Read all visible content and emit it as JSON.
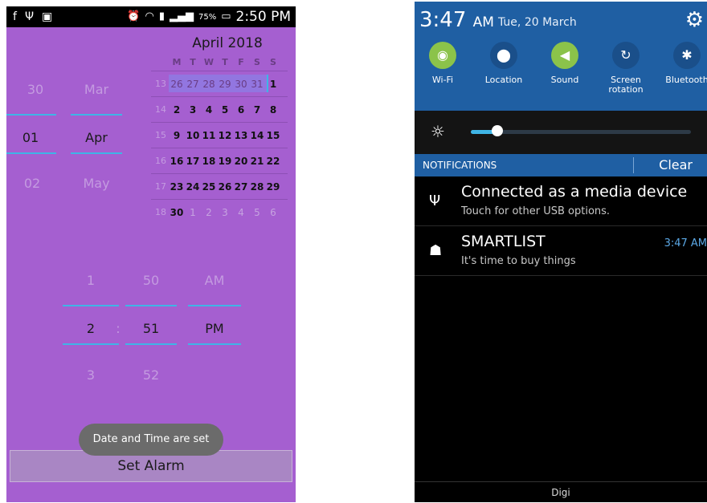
{
  "left_phone": {
    "status_bar": {
      "left_icons": [
        "facebook-icon",
        "usb-icon",
        "image-icon"
      ],
      "battery_percent": "75%",
      "time": "2:50 PM"
    },
    "date_picker": {
      "day": {
        "prev": "30",
        "selected": "01",
        "next": "02"
      },
      "month": {
        "prev": "Mar",
        "selected": "Apr",
        "next": "May"
      }
    },
    "calendar": {
      "title": "April 2018",
      "weekday_headers": [
        "M",
        "T",
        "W",
        "T",
        "F",
        "S",
        "S"
      ],
      "weeks": [
        {
          "week": "13",
          "days": [
            "26",
            "27",
            "28",
            "29",
            "30",
            "31",
            "1"
          ]
        },
        {
          "week": "14",
          "days": [
            "2",
            "3",
            "4",
            "5",
            "6",
            "7",
            "8"
          ]
        },
        {
          "week": "15",
          "days": [
            "9",
            "10",
            "11",
            "12",
            "13",
            "14",
            "15"
          ]
        },
        {
          "week": "16",
          "days": [
            "16",
            "17",
            "18",
            "19",
            "20",
            "21",
            "22"
          ]
        },
        {
          "week": "17",
          "days": [
            "23",
            "24",
            "25",
            "26",
            "27",
            "28",
            "29"
          ]
        },
        {
          "week": "18",
          "days": [
            "30",
            "1",
            "2",
            "3",
            "4",
            "5",
            "6"
          ]
        }
      ]
    },
    "time_picker": {
      "hour": {
        "prev": "1",
        "selected": "2",
        "next": "3"
      },
      "separator": ":",
      "minute": {
        "prev": "50",
        "selected": "51",
        "next": "52"
      },
      "ampm": {
        "prev": "AM",
        "selected": "PM"
      }
    },
    "toast": "Date and Time are set",
    "set_alarm_label": "Set Alarm",
    "colors": {
      "background": "#a55fd0",
      "accent_line": "#3fb5e6"
    }
  },
  "right_phone": {
    "time": "3:47",
    "ampm": "AM",
    "date": "Tue, 20 March",
    "quick_settings": [
      {
        "label": "Wi-Fi",
        "icon": "wifi-icon",
        "on": true
      },
      {
        "label": "Location",
        "icon": "location-icon",
        "on": false
      },
      {
        "label": "Sound",
        "icon": "sound-icon",
        "on": true
      },
      {
        "label": "Screen rotation",
        "icon": "rotation-icon",
        "on": false
      },
      {
        "label": "Bluetooth",
        "icon": "bluetooth-icon",
        "on": false
      }
    ],
    "brightness_level": 0.12,
    "notifications_header": "NOTIFICATIONS",
    "clear_label": "Clear",
    "notifications": [
      {
        "icon": "usb-icon",
        "title": "Connected as a media device",
        "subtitle": "Touch for other USB options.",
        "time": ""
      },
      {
        "icon": "android-icon",
        "title": "SMARTLIST",
        "subtitle": "It's time to buy things",
        "time": "3:47 AM"
      }
    ],
    "carrier": "Digi",
    "colors": {
      "panel": "#1f5fa3",
      "tile_on": "#8bc34a",
      "tile_off": "#1a4f8a"
    }
  }
}
